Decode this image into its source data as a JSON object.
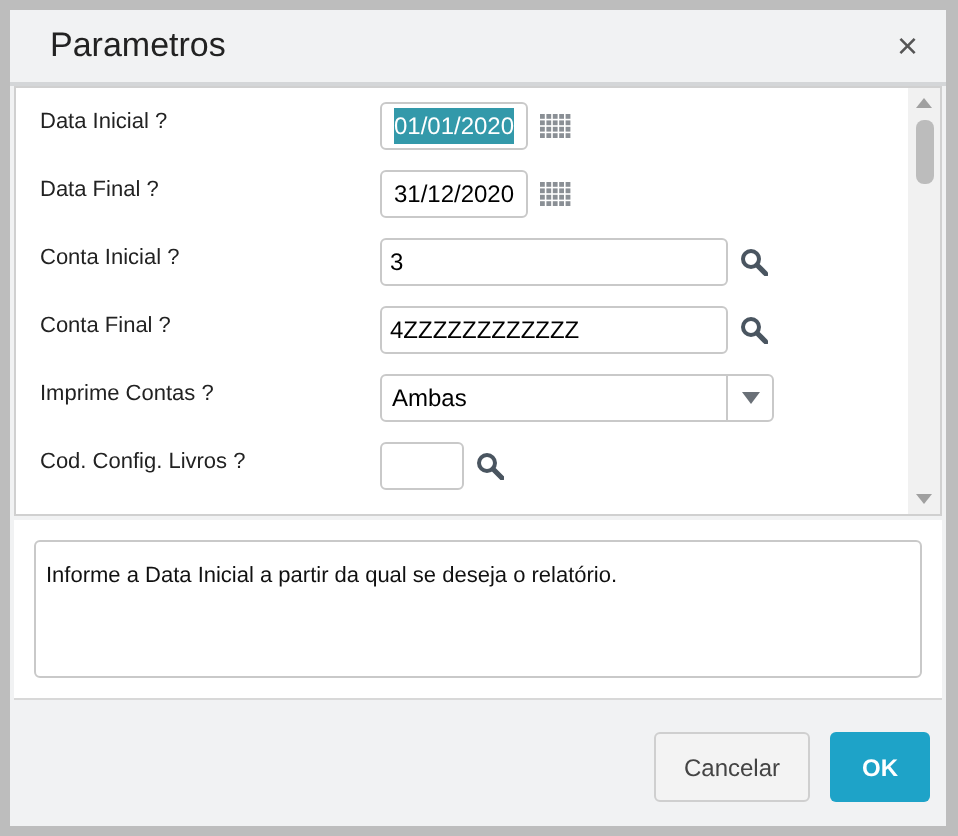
{
  "dialog": {
    "title": "Parametros",
    "close": "×"
  },
  "parameters": [
    {
      "label": "Data Inicial ?",
      "kind": "date",
      "value": "01/01/2020",
      "selected": true
    },
    {
      "label": "Data Final ?",
      "kind": "date",
      "value": "31/12/2020",
      "selected": false
    },
    {
      "label": "Conta Inicial ?",
      "kind": "lookup",
      "value": "3",
      "selected": false
    },
    {
      "label": "Conta Final ?",
      "kind": "lookup",
      "value": "4ZZZZZZZZZZZZ",
      "selected": false
    },
    {
      "label": "Imprime Contas ?",
      "kind": "select",
      "value": "Ambas",
      "selected": false
    },
    {
      "label": "Cod. Config. Livros ?",
      "kind": "short_lookup",
      "selected": false
    }
  ],
  "help_text": "Informe a Data Inicial a partir da qual se deseja o relatório.",
  "buttons": [
    {
      "label": "Cancelar",
      "kind": "secondary"
    },
    {
      "label": "OK",
      "kind": "primary"
    }
  ]
}
